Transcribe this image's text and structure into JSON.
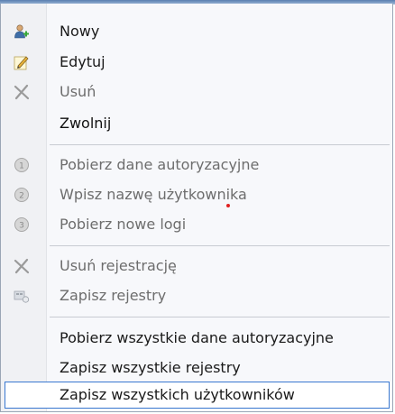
{
  "menu": {
    "items": [
      {
        "label": "Nowy",
        "icon": "add-user-icon",
        "enabled": true
      },
      {
        "label": "Edytuj",
        "icon": "edit-pencil-icon",
        "enabled": true
      },
      {
        "label": "Usuń",
        "icon": "delete-x-icon",
        "enabled": false
      },
      {
        "label": "Zwolnij",
        "icon": "",
        "enabled": true
      },
      {
        "label": "Pobierz dane autoryzacyjne",
        "icon": "step-1-icon",
        "enabled": false
      },
      {
        "label": "Wpisz nazwę użytkownika",
        "icon": "step-2-icon",
        "enabled": false
      },
      {
        "label": "Pobierz nowe logi",
        "icon": "step-3-icon",
        "enabled": false
      },
      {
        "label": "Usuń rejestrację",
        "icon": "delete-x-icon",
        "enabled": false
      },
      {
        "label": "Zapisz rejestry",
        "icon": "save-registry-icon",
        "enabled": false
      },
      {
        "label": "Pobierz wszystkie dane autoryzacyjne",
        "icon": "",
        "enabled": true
      },
      {
        "label": "Zapisz wszystkie rejestry",
        "icon": "",
        "enabled": true
      },
      {
        "label": "Zapisz wszystkich użytkowników",
        "icon": "",
        "enabled": true,
        "highlighted": true
      }
    ]
  },
  "colors": {
    "highlight_border": "#3a78d0",
    "separator": "#c7cbd2",
    "disabled_text": "#6d6d6d"
  }
}
